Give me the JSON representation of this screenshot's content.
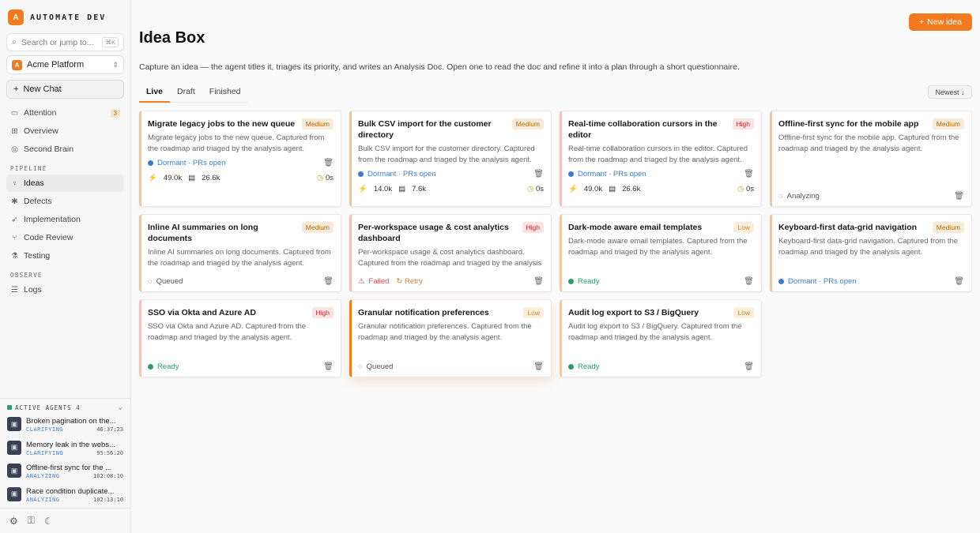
{
  "brand": {
    "logo": "A",
    "name": "AUTOMATE DEV"
  },
  "search": {
    "placeholder": "Search or jump to...",
    "shortcut": "⌘K"
  },
  "workspace": {
    "logo": "A",
    "name": "Acme Platform"
  },
  "new_chat": "New Chat",
  "nav_top": [
    {
      "label": "Attention",
      "icon": "inbox-icon",
      "badge": "3"
    },
    {
      "label": "Overview",
      "icon": "grid-icon"
    },
    {
      "label": "Second Brain",
      "icon": "brain-icon"
    }
  ],
  "sections": {
    "pipeline": "PIPELINE",
    "observe": "OBSERVE"
  },
  "nav_pipeline": [
    {
      "label": "Ideas",
      "icon": "lightbulb-icon",
      "active": true
    },
    {
      "label": "Defects",
      "icon": "bug-icon"
    },
    {
      "label": "Implementation",
      "icon": "rocket-icon"
    },
    {
      "label": "Code Review",
      "icon": "branch-icon"
    },
    {
      "label": "Testing",
      "icon": "flask-icon"
    }
  ],
  "nav_observe": [
    {
      "label": "Logs",
      "icon": "logs-icon"
    }
  ],
  "agents": {
    "title": "ACTIVE AGENTS",
    "count": "4",
    "items": [
      {
        "name": "Broken pagination on the...",
        "status": "CLARIFYING",
        "time": "46:37:23"
      },
      {
        "name": "Memory leak in the webs...",
        "status": "CLARIFYING",
        "time": "95:56:20"
      },
      {
        "name": "Offline-first sync for the ...",
        "status": "ANALYZING",
        "time": "102:08:10"
      },
      {
        "name": "Race condition duplicate...",
        "status": "ANALYZING",
        "time": "102:13:10"
      }
    ]
  },
  "page": {
    "title": "Idea Box",
    "new_button": "New idea",
    "subtitle": "Capture an idea — the agent titles it, triages its priority, and writes an Analysis Doc. Open one to read the doc and refine it into a plan through a short questionnaire.",
    "tabs": [
      "Live",
      "Draft",
      "Finished"
    ],
    "sort": "Newest ↓"
  },
  "cards": [
    {
      "title": "Migrate legacy jobs to the new queue",
      "priority": "Medium",
      "desc": "Migrate legacy jobs to the new queue. Captured from the roadmap and triaged by the analysis agent.",
      "status": "Dormant · PRs open",
      "tokens": "49.0k",
      "files": "26.6k",
      "time": "0s"
    },
    {
      "title": "Bulk CSV import for the customer directory",
      "priority": "Medium",
      "desc": "Bulk CSV import for the customer directory. Captured from the roadmap and triaged by the analysis agent.",
      "status": "Dormant · PRs open",
      "tokens": "14.0k",
      "files": "7.6k",
      "time": "0s"
    },
    {
      "title": "Real-time collaboration cursors in the editor",
      "priority": "High",
      "desc": "Real-time collaboration cursors in the editor. Captured from the roadmap and triaged by the analysis agent.",
      "status": "Dormant · PRs open",
      "tokens": "49.0k",
      "files": "26.6k",
      "time": "0s"
    },
    {
      "title": "Offline-first sync for the mobile app",
      "priority": "Medium",
      "desc": "Offline-first sync for the mobile app. Captured from the roadmap and triaged by the analysis agent.",
      "status": "Analyzing"
    },
    {
      "title": "Inline AI summaries on long documents",
      "priority": "Medium",
      "desc": "Inline AI summaries on long documents. Captured from the roadmap and triaged by the analysis agent.",
      "status": "Queued"
    },
    {
      "title": "Per-workspace usage & cost analytics dashboard",
      "priority": "High",
      "desc": "Per-workspace usage & cost analytics dashboard. Captured from the roadmap and triaged by the analysis agent.",
      "status": "Failed",
      "retry": "Retry"
    },
    {
      "title": "Dark-mode aware email templates",
      "priority": "Low",
      "desc": "Dark-mode aware email templates. Captured from the roadmap and triaged by the analysis agent.",
      "status": "Ready"
    },
    {
      "title": "Keyboard-first data-grid navigation",
      "priority": "Medium",
      "desc": "Keyboard-first data-grid navigation. Captured from the roadmap and triaged by the analysis agent.",
      "status": "Dormant · PRs open"
    },
    {
      "title": "SSO via Okta and Azure AD",
      "priority": "High",
      "desc": "SSO via Okta and Azure AD. Captured from the roadmap and triaged by the analysis agent.",
      "status": "Ready"
    },
    {
      "title": "Granular notification preferences",
      "priority": "Low",
      "desc": "Granular notification preferences. Captured from the roadmap and triaged by the analysis agent.",
      "status": "Queued"
    },
    {
      "title": "Audit log export to S3 / BigQuery",
      "priority": "Low",
      "desc": "Audit log export to S3 / BigQuery. Captured from the roadmap and triaged by the analysis agent.",
      "status": "Ready"
    }
  ],
  "colors": {
    "accent": "#f47a1f",
    "dormant": "#3a7bd5",
    "ready": "#2a9d6b",
    "failed": "#d84c4c"
  }
}
